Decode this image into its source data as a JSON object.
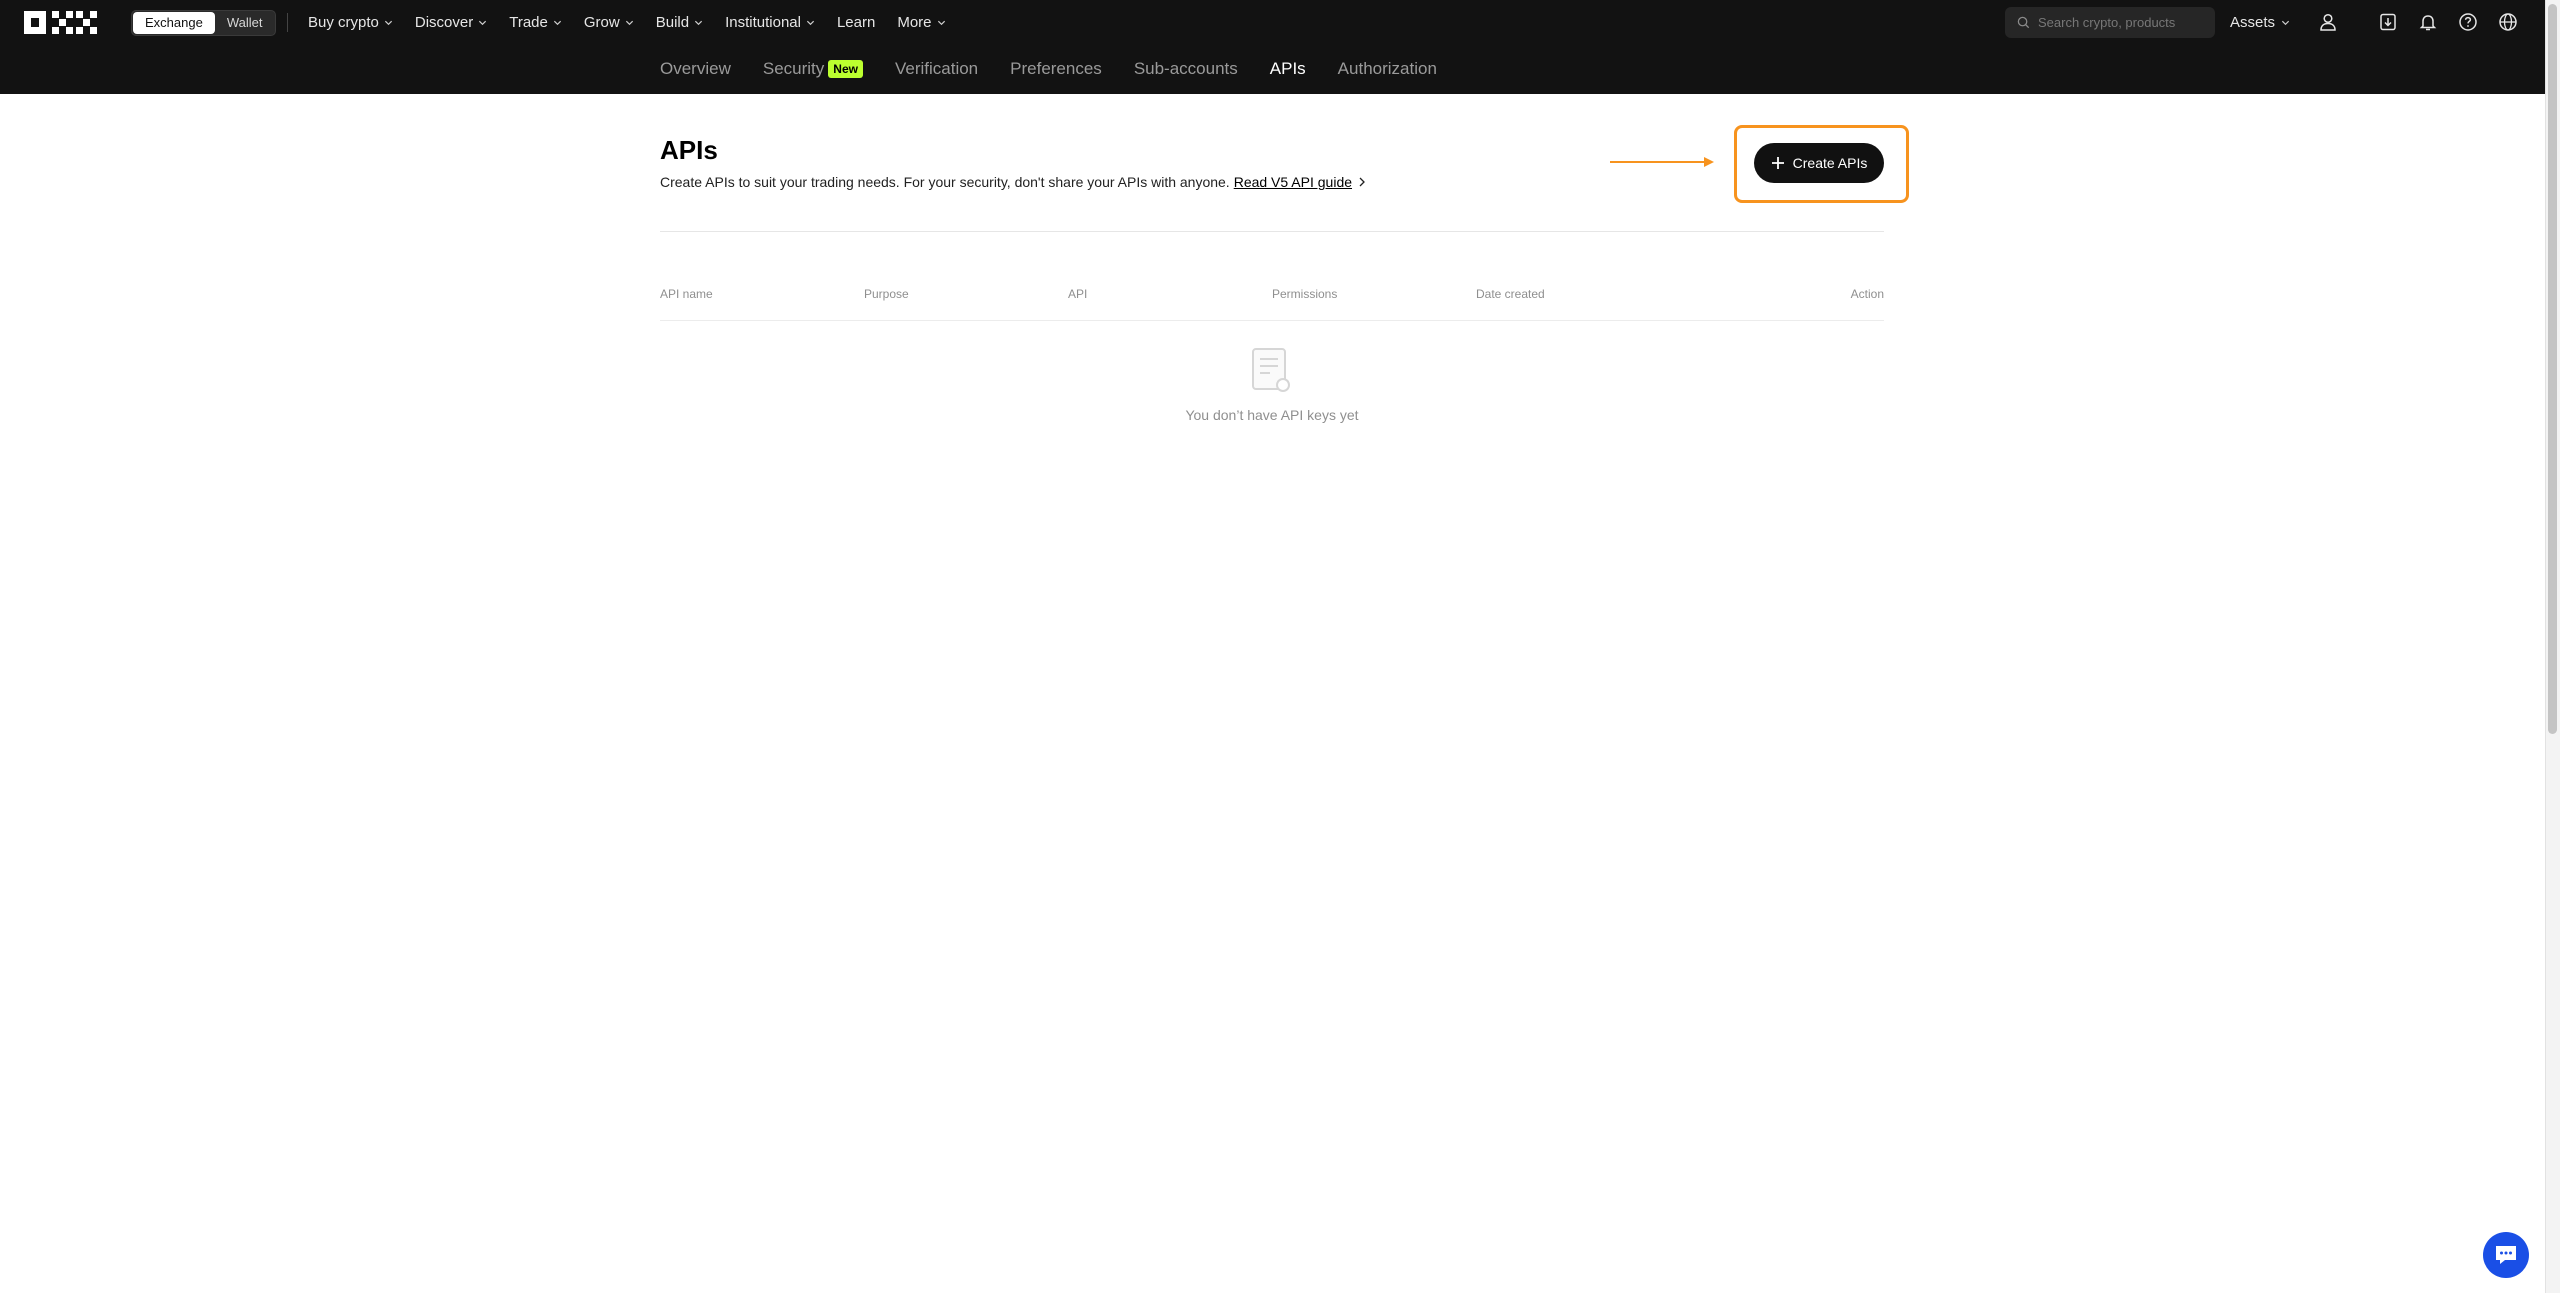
{
  "header": {
    "mode_toggle": {
      "exchange": "Exchange",
      "wallet": "Wallet"
    },
    "nav": [
      {
        "label": "Buy crypto",
        "dropdown": true
      },
      {
        "label": "Discover",
        "dropdown": true
      },
      {
        "label": "Trade",
        "dropdown": true
      },
      {
        "label": "Grow",
        "dropdown": true
      },
      {
        "label": "Build",
        "dropdown": true
      },
      {
        "label": "Institutional",
        "dropdown": true
      },
      {
        "label": "Learn",
        "dropdown": false
      },
      {
        "label": "More",
        "dropdown": true
      }
    ],
    "search": {
      "placeholder": "Search crypto, products",
      "icon": "search-icon"
    },
    "assets_label": "Assets",
    "icons": [
      "user-icon",
      "download-icon",
      "bell-icon",
      "help-icon",
      "globe-icon"
    ]
  },
  "subnav": {
    "items": [
      {
        "label": "Overview"
      },
      {
        "label": "Security",
        "badge": "New"
      },
      {
        "label": "Verification"
      },
      {
        "label": "Preferences"
      },
      {
        "label": "Sub-accounts"
      },
      {
        "label": "APIs",
        "active": true
      },
      {
        "label": "Authorization"
      }
    ]
  },
  "main": {
    "title": "APIs",
    "description": "Create APIs to suit your trading needs. For your security, don't share your APIs with anyone.",
    "guide_link": "Read V5 API guide",
    "create_button": "Create APIs",
    "table": {
      "columns": [
        "API name",
        "Purpose",
        "API",
        "Permissions",
        "Date created",
        "Action"
      ],
      "rows": [],
      "empty_text": "You don’t have API keys yet"
    }
  },
  "colors": {
    "header_bg": "#121212",
    "badge_green": "#bcff2f",
    "highlight_orange": "#f7931e",
    "chat_blue": "#1a4fe6"
  }
}
